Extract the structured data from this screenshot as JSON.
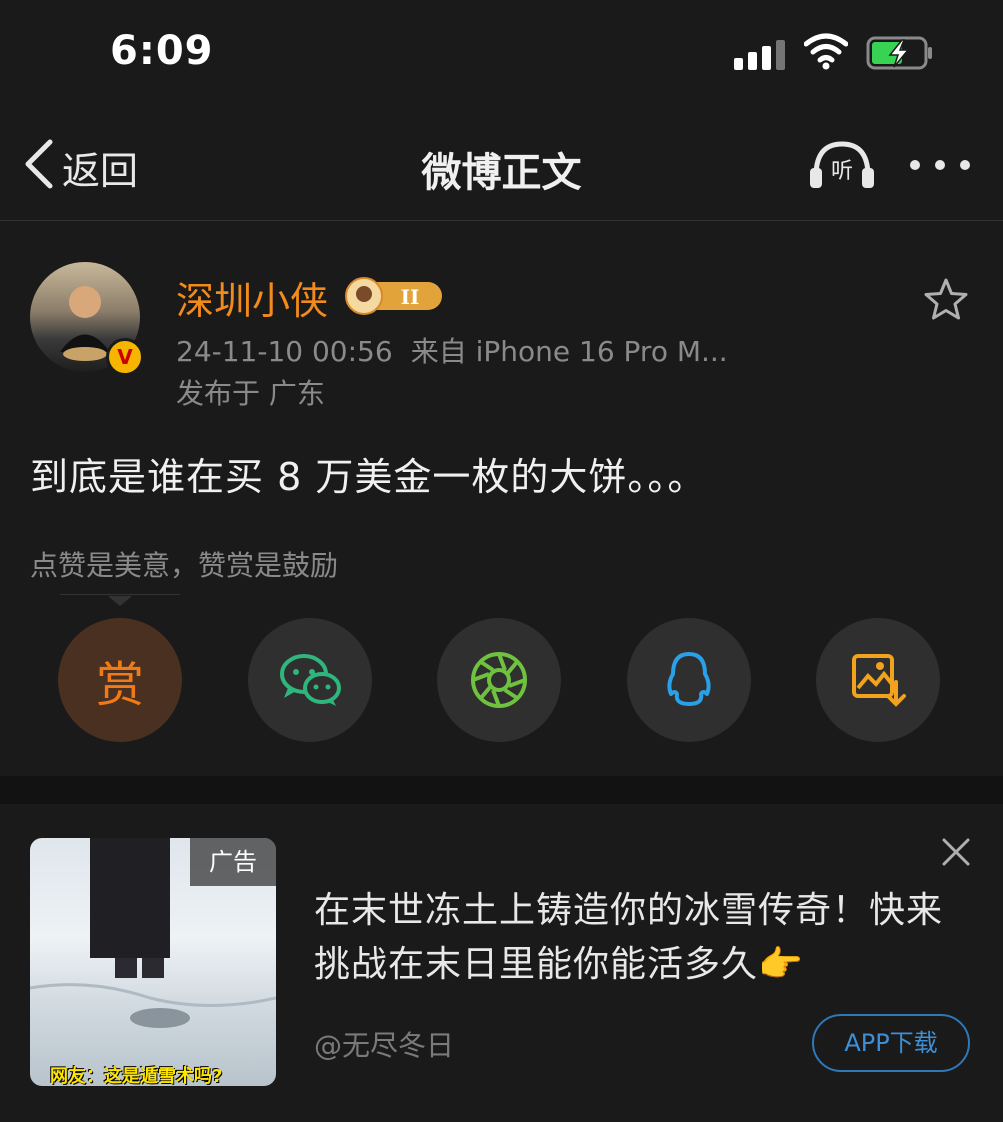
{
  "status_bar": {
    "time": "6:09"
  },
  "nav": {
    "back_label": "返回",
    "title": "微博正文",
    "listen_label": "听"
  },
  "post": {
    "username": "深圳小侠",
    "level_badge": "II",
    "timestamp": "24-11-10 00:56",
    "source": "来自 iPhone 16 Pro M...",
    "location": "发布于 广东",
    "text": "到底是谁在买 8 万美金一枚的大饼。。。",
    "reward_hint": "点赞是美意，赞赏是鼓励",
    "reward_label": "赏"
  },
  "share_icons": [
    "reward-icon",
    "wechat-icon",
    "moments-icon",
    "qq-icon",
    "save-image-icon"
  ],
  "ad": {
    "tag": "广告",
    "caption": "网友：这是遁雪术吗?",
    "text": "在末世冻土上铸造你的冰雪传奇！快来挑战在末日里能你能活多久👉",
    "source": "@无尽冬日",
    "button_label": "APP下载"
  },
  "colors": {
    "background": "#1a1a1a",
    "username": "#f28b1c",
    "reward": "#f07a16",
    "wechat": "#2fb67c",
    "moments": "#6fc23d",
    "qq": "#2aa0e8",
    "save": "#f2a21c",
    "ad_button": "#3d8fd6"
  }
}
